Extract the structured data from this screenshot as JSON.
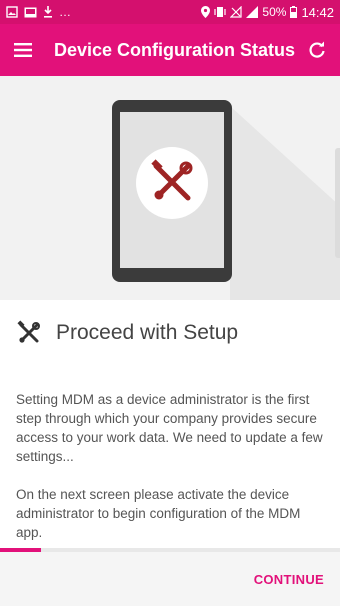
{
  "statusbar": {
    "battery": "50%",
    "time": "14:42"
  },
  "appbar": {
    "title": "Device Configuration Status"
  },
  "content": {
    "heading": "Proceed with Setup",
    "paragraph1": "Setting MDM as a device administrator is the first step through which your company provides secure access to your work data. We need to update a few settings...",
    "paragraph2": "On the next screen please activate the device administrator to begin configuration of the MDM app."
  },
  "progress": {
    "fraction": 0.12
  },
  "footer": {
    "continue_label": "CONTINUE"
  },
  "colors": {
    "accent": "#e2117a",
    "statusbar": "#d4106e",
    "tool_icon": "#9e2424"
  }
}
